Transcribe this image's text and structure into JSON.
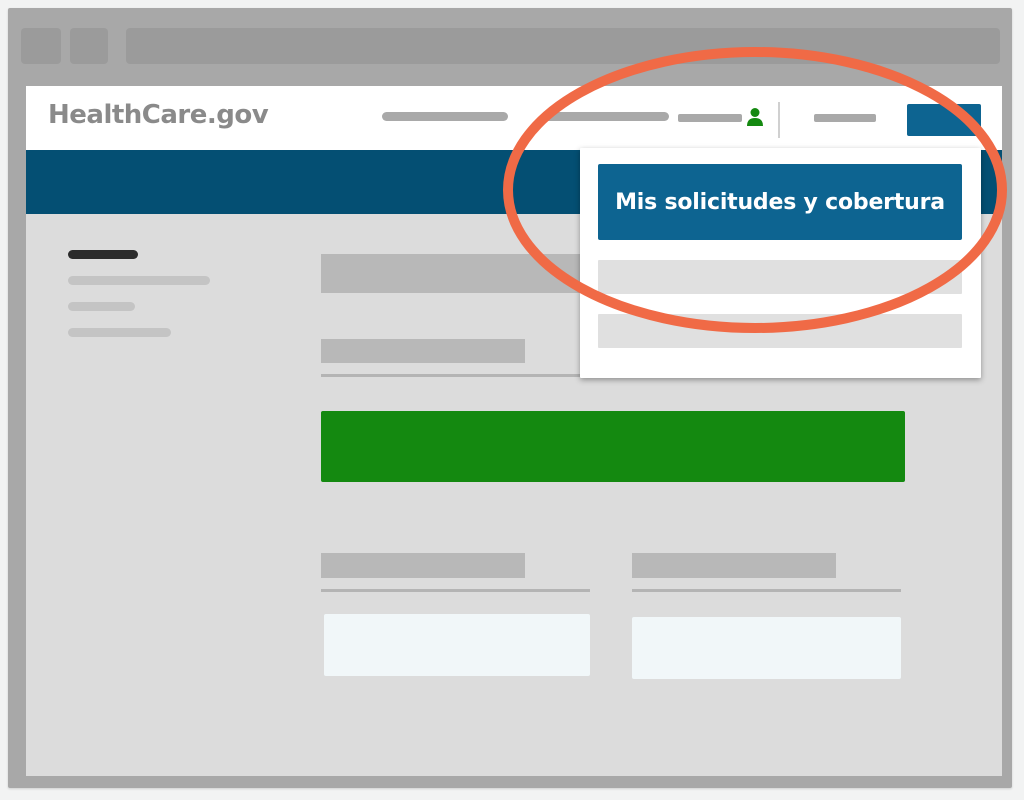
{
  "site": {
    "logo_text": "HealthCare.gov"
  },
  "dropdown": {
    "primary_label": "Mis solicitudes y cobertura"
  },
  "colors": {
    "brand_blue": "#0d6491",
    "band_blue": "#044f73",
    "action_green": "#148910",
    "user_icon_green": "#148910",
    "highlight_orange": "#f06a46"
  },
  "icons": {
    "user": "user-icon"
  }
}
